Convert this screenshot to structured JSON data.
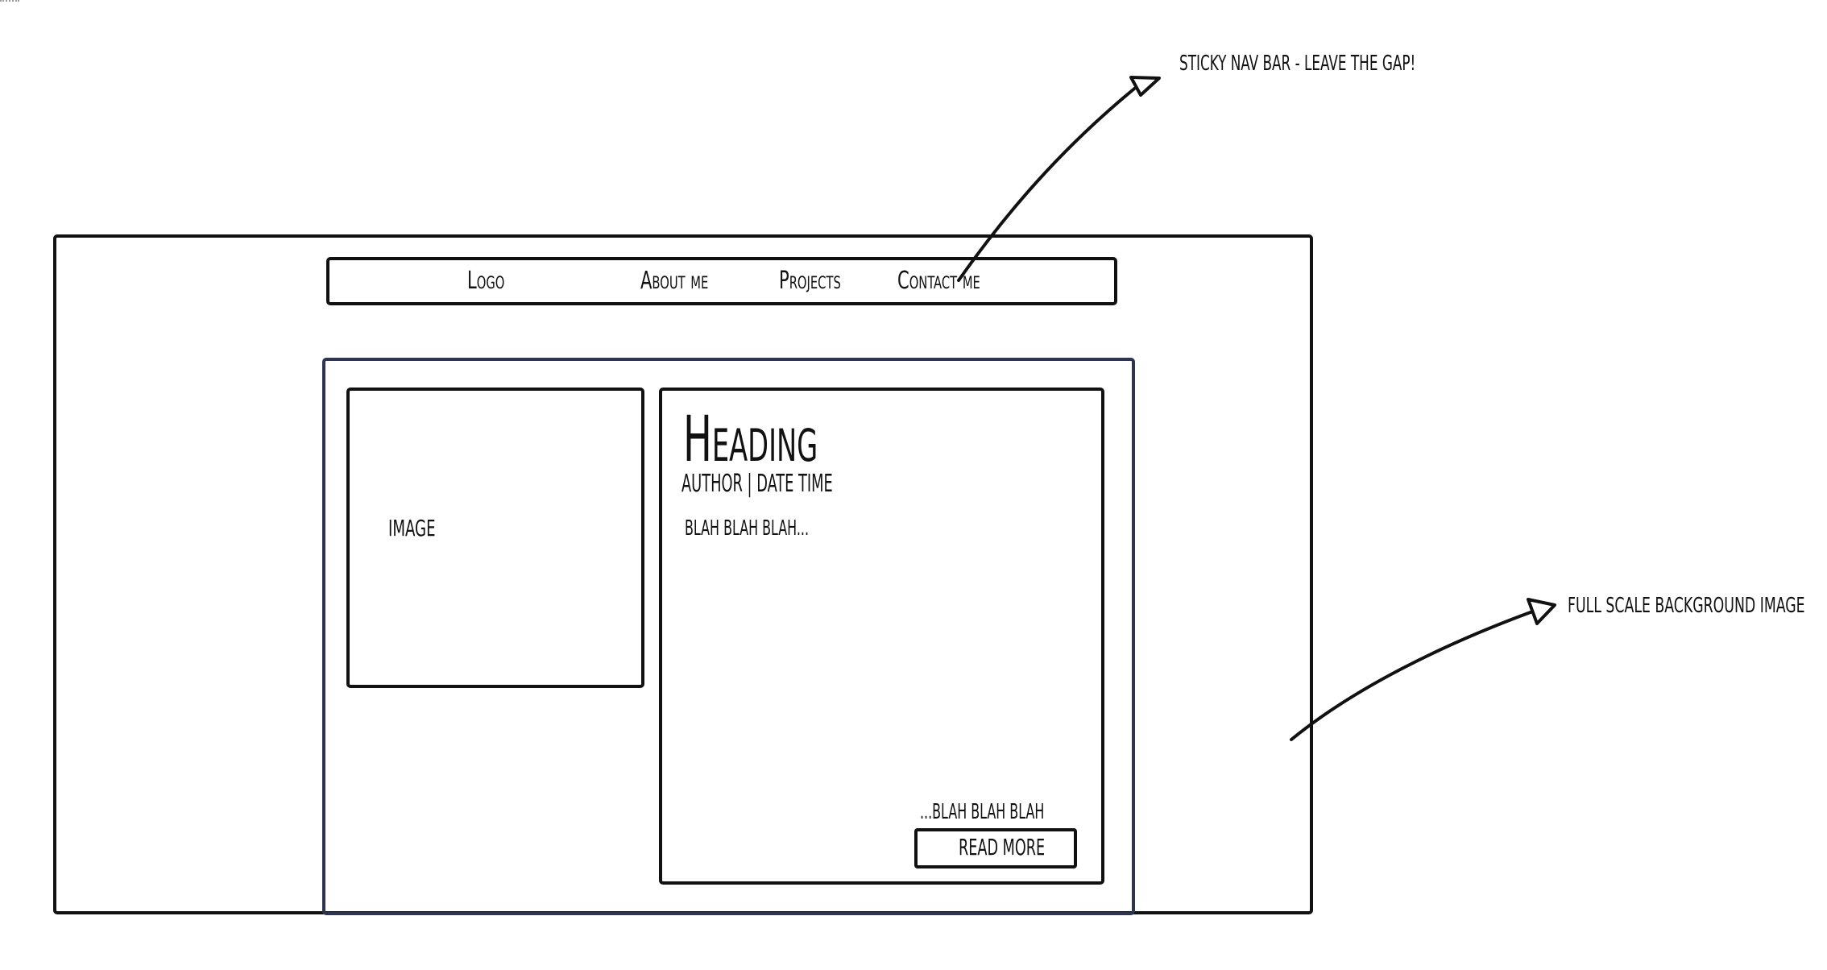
{
  "wireframe": {
    "navigation": {
      "logo": "Logo",
      "about": "About me",
      "projects": "Projects",
      "contact": "Contact me"
    },
    "image_placeholder": "IMAGE",
    "article": {
      "heading": "Heading",
      "meta": "AUTHOR | DATE TIME",
      "intro_text": "BLAH BLAH BLAH...",
      "closing_text": "...BLAH BLAH BLAH",
      "read_more_label": "READ MORE"
    },
    "annotations": {
      "sticky_nav": "STICKY NAV BAR - LEAVE THE GAP!",
      "background": "FULL SCALE BACKGROUND IMAGE"
    }
  }
}
